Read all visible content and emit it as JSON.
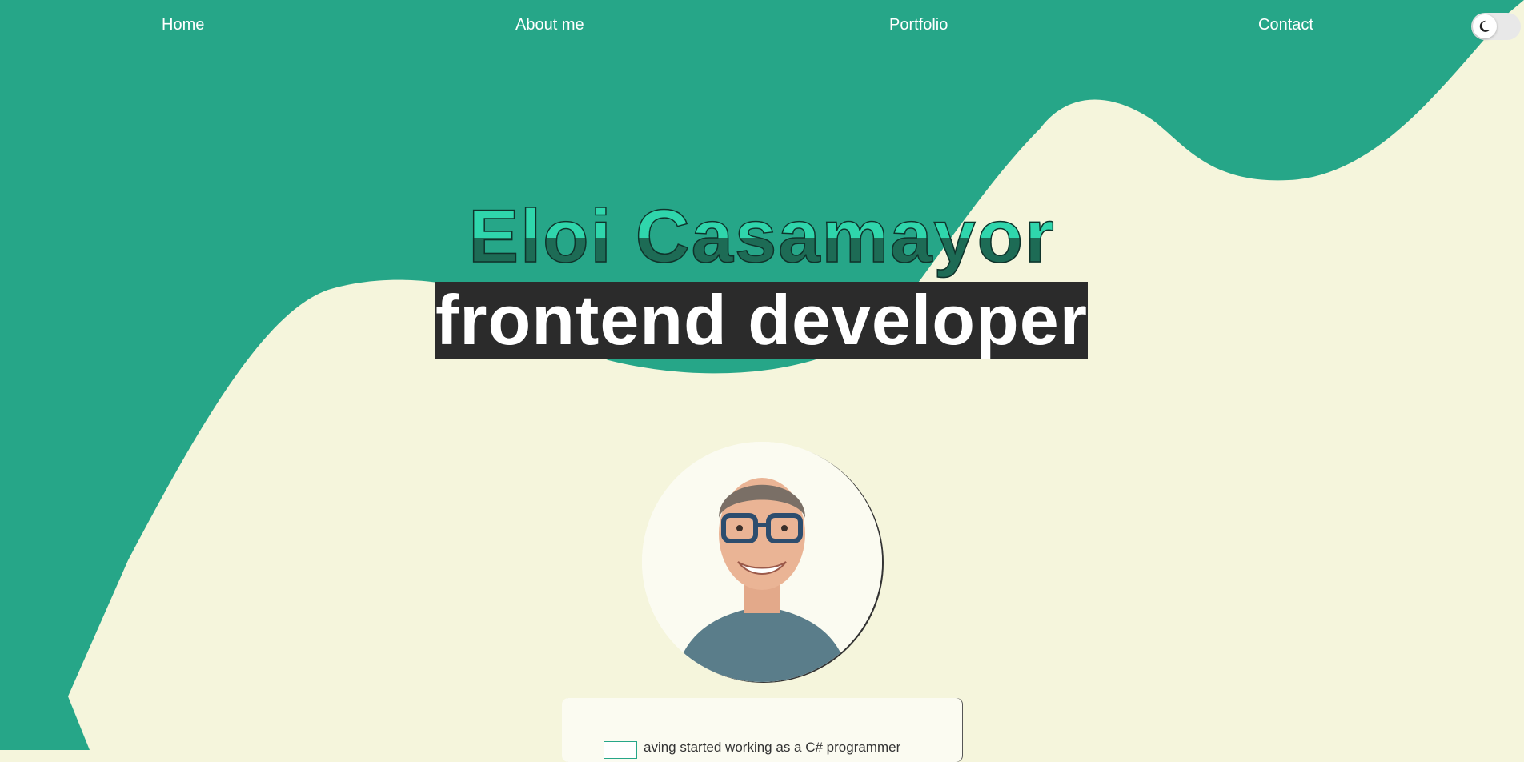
{
  "nav": {
    "items": [
      {
        "label": "Home"
      },
      {
        "label": "About me"
      },
      {
        "label": "Portfolio"
      },
      {
        "label": "Contact"
      }
    ]
  },
  "theme_toggle": {
    "icon": "moon-icon",
    "state": "light"
  },
  "hero": {
    "name": "Eloi Casamayor",
    "role": "frontend developer"
  },
  "avatar": {
    "icon": "profile-photo"
  },
  "about": {
    "text_fragment": "aving started working as a C# programmer"
  },
  "colors": {
    "primary": "#26a688",
    "background": "#f5f5dc",
    "name_light": "#2fd6ac",
    "name_dark": "#1d6b55",
    "role_bg": "#2b2b2b",
    "text_white": "#ffffff"
  }
}
